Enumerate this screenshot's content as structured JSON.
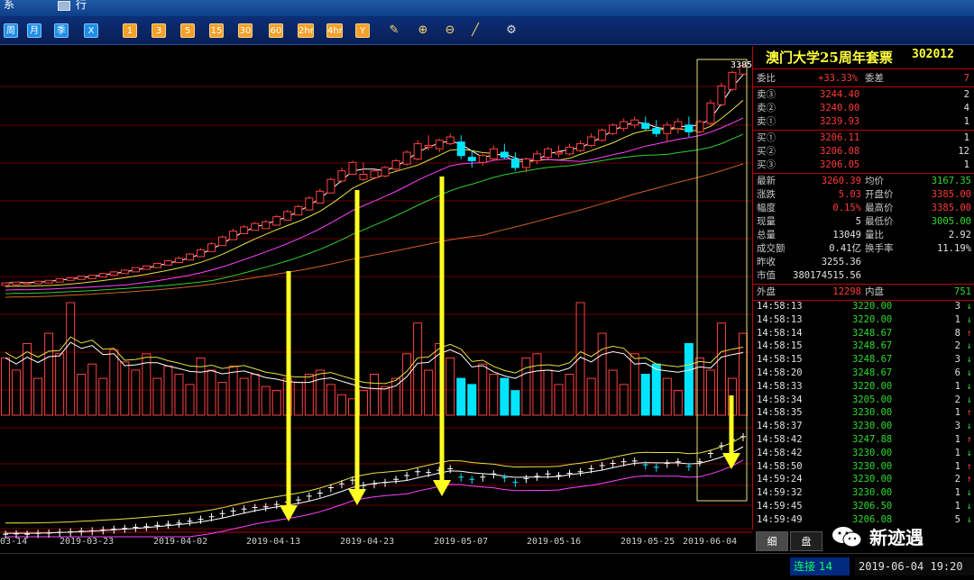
{
  "window": {
    "title_left": "系",
    "title_right": "行"
  },
  "toolbar": {
    "buttons": [
      {
        "label": "周",
        "style": "blue"
      },
      {
        "label": "月",
        "style": "blue"
      },
      {
        "label": "季",
        "style": "blue"
      },
      {
        "label": "X",
        "style": "blue"
      },
      {
        "label": "1",
        "style": "orange"
      },
      {
        "label": "3",
        "style": "orange"
      },
      {
        "label": "5",
        "style": "orange"
      },
      {
        "label": "15",
        "style": "orange"
      },
      {
        "label": "30",
        "style": "orange"
      },
      {
        "label": "60",
        "style": "orange"
      },
      {
        "label": "2hr",
        "style": "orange"
      },
      {
        "label": "4hr",
        "style": "orange"
      },
      {
        "label": "Y",
        "style": "orange"
      }
    ],
    "icons": [
      "notepad-icon",
      "zoom-in-icon",
      "zoom-out-icon",
      "draw-line-icon",
      "settings-gear-icon"
    ]
  },
  "chart_data": {
    "type": "candlestick",
    "xlabels": [
      "03-14",
      "2019-03-23",
      "2019-04-02",
      "2019-04-13",
      "2019-04-23",
      "2019-05-07",
      "2019-05-16",
      "2019-05-25",
      "2019-06-04"
    ],
    "last_price_label": "3385",
    "price_series": [
      [
        1,
        3,
        2,
        4
      ],
      [
        2,
        4,
        3,
        5
      ],
      [
        3,
        5,
        2,
        4
      ],
      [
        3,
        6,
        4,
        6
      ],
      [
        4,
        7,
        5,
        7
      ],
      [
        5,
        9,
        6,
        9
      ],
      [
        7,
        10,
        8,
        10
      ],
      [
        8,
        12,
        9,
        12
      ],
      [
        9,
        13,
        11,
        13
      ],
      [
        11,
        16,
        12,
        15
      ],
      [
        13,
        18,
        14,
        17
      ],
      [
        15,
        20,
        16,
        19
      ],
      [
        17,
        22,
        19,
        22
      ],
      [
        20,
        25,
        21,
        24
      ],
      [
        22,
        28,
        24,
        27
      ],
      [
        25,
        31,
        26,
        30
      ],
      [
        28,
        35,
        29,
        33
      ],
      [
        31,
        39,
        33,
        38
      ],
      [
        35,
        45,
        37,
        43
      ],
      [
        41,
        52,
        43,
        50
      ],
      [
        48,
        60,
        50,
        58
      ],
      [
        55,
        68,
        57,
        65
      ],
      [
        62,
        72,
        63,
        70
      ],
      [
        66,
        76,
        68,
        74
      ],
      [
        68,
        78,
        70,
        76
      ],
      [
        72,
        84,
        74,
        82
      ],
      [
        78,
        90,
        80,
        88
      ],
      [
        84,
        96,
        86,
        94
      ],
      [
        90,
        106,
        92,
        104
      ],
      [
        98,
        115,
        100,
        112
      ],
      [
        110,
        128,
        112,
        126
      ],
      [
        124,
        140,
        122,
        136
      ],
      [
        132,
        148,
        134,
        146
      ],
      [
        126,
        146,
        124,
        132
      ],
      [
        128,
        138,
        126,
        136
      ],
      [
        130,
        142,
        128,
        140
      ],
      [
        138,
        150,
        136,
        148
      ],
      [
        144,
        160,
        142,
        158
      ],
      [
        150,
        172,
        148,
        168
      ],
      [
        164,
        178,
        160,
        166
      ],
      [
        162,
        174,
        158,
        172
      ],
      [
        168,
        180,
        166,
        176
      ],
      [
        170,
        178,
        150,
        154
      ],
      [
        152,
        160,
        140,
        148
      ],
      [
        146,
        156,
        142,
        154
      ],
      [
        150,
        166,
        148,
        162
      ],
      [
        158,
        168,
        150,
        152
      ],
      [
        150,
        158,
        136,
        140
      ],
      [
        140,
        152,
        134,
        150
      ],
      [
        148,
        160,
        144,
        156
      ],
      [
        152,
        164,
        150,
        162
      ],
      [
        156,
        166,
        152,
        158
      ],
      [
        156,
        168,
        154,
        164
      ],
      [
        160,
        172,
        158,
        168
      ],
      [
        166,
        180,
        164,
        176
      ],
      [
        172,
        186,
        170,
        184
      ],
      [
        180,
        192,
        178,
        190
      ],
      [
        186,
        198,
        182,
        194
      ],
      [
        190,
        200,
        186,
        196
      ],
      [
        192,
        200,
        184,
        186
      ],
      [
        186,
        196,
        176,
        180
      ],
      [
        180,
        194,
        170,
        190
      ],
      [
        186,
        198,
        180,
        194
      ],
      [
        190,
        200,
        176,
        182
      ],
      [
        182,
        196,
        180,
        194
      ],
      [
        192,
        220,
        190,
        216
      ],
      [
        214,
        240,
        212,
        236
      ],
      [
        232,
        254,
        230,
        252
      ],
      [
        250,
        262,
        248,
        260
      ]
    ],
    "volume_series": [
      28,
      22,
      35,
      18,
      40,
      30,
      55,
      20,
      25,
      18,
      32,
      26,
      22,
      30,
      18,
      24,
      20,
      15,
      28,
      22,
      16,
      24,
      18,
      20,
      14,
      12,
      18,
      16,
      20,
      22,
      15,
      10,
      8,
      12,
      20,
      14,
      18,
      30,
      45,
      22,
      35,
      28,
      18,
      15,
      25,
      20,
      18,
      12,
      28,
      30,
      22,
      15,
      20,
      55,
      18,
      40,
      22,
      15,
      30,
      20,
      25,
      18,
      12,
      35,
      28,
      22,
      45,
      18,
      40
    ],
    "annotations": [
      "down-arrow",
      "down-arrow",
      "down-arrow",
      "down-arrow"
    ]
  },
  "quote": {
    "name": "澳门大学25周年套票",
    "code": "302012",
    "weibi_label": "委比",
    "weibi_value": "+33.33%",
    "weicha_label": "委差",
    "weicha_value": "7",
    "asks": [
      {
        "label": "卖③",
        "price": "3244.40",
        "qty": "2"
      },
      {
        "label": "卖②",
        "price": "3240.00",
        "qty": "4"
      },
      {
        "label": "卖①",
        "price": "3239.93",
        "qty": "1"
      }
    ],
    "bids": [
      {
        "label": "买①",
        "price": "3206.11",
        "qty": "1"
      },
      {
        "label": "买②",
        "price": "3206.08",
        "qty": "12"
      },
      {
        "label": "买③",
        "price": "3206.05",
        "qty": "1"
      }
    ],
    "stats": [
      {
        "l1": "最新",
        "v1": "3260.39",
        "c1": "red",
        "l2": "均价",
        "v2": "3167.35",
        "c2": "green"
      },
      {
        "l1": "涨跌",
        "v1": "5.03",
        "c1": "red",
        "l2": "开盘价",
        "v2": "3385.00",
        "c2": "red"
      },
      {
        "l1": "幅度",
        "v1": "0.15%",
        "c1": "red",
        "l2": "最高价",
        "v2": "3385.00",
        "c2": "red"
      },
      {
        "l1": "现量",
        "v1": "5",
        "c1": "white",
        "l2": "最低价",
        "v2": "3005.00",
        "c2": "green"
      },
      {
        "l1": "总量",
        "v1": "13049",
        "c1": "white",
        "l2": "量比",
        "v2": "2.92",
        "c2": "white"
      },
      {
        "l1": "成交额",
        "v1": "0.41亿",
        "c1": "white",
        "l2": "换手率",
        "v2": "11.19%",
        "c2": "white"
      }
    ],
    "prev_close_label": "昨收",
    "prev_close": "3255.36",
    "market_value_label": "市值",
    "market_value": "380174515.56",
    "outer_label": "外盘",
    "outer_value": "12298",
    "inner_label": "内盘",
    "inner_value": "751"
  },
  "ticks": [
    {
      "time": "14:58:13",
      "price": "3220.00",
      "qty": "3",
      "dir": "down"
    },
    {
      "time": "14:58:13",
      "price": "3220.00",
      "qty": "1",
      "dir": "down"
    },
    {
      "time": "14:58:14",
      "price": "3248.67",
      "qty": "8",
      "dir": "up"
    },
    {
      "time": "14:58:15",
      "price": "3248.67",
      "qty": "2",
      "dir": "down"
    },
    {
      "time": "14:58:15",
      "price": "3248.67",
      "qty": "3",
      "dir": "down"
    },
    {
      "time": "14:58:20",
      "price": "3248.67",
      "qty": "6",
      "dir": "down"
    },
    {
      "time": "14:58:33",
      "price": "3220.00",
      "qty": "1",
      "dir": "down"
    },
    {
      "time": "14:58:34",
      "price": "3205.00",
      "qty": "2",
      "dir": "down"
    },
    {
      "time": "14:58:35",
      "price": "3230.00",
      "qty": "1",
      "dir": "up"
    },
    {
      "time": "14:58:37",
      "price": "3230.00",
      "qty": "3",
      "dir": "down"
    },
    {
      "time": "14:58:42",
      "price": "3247.88",
      "qty": "1",
      "dir": "up"
    },
    {
      "time": "14:58:42",
      "price": "3230.00",
      "qty": "1",
      "dir": "down"
    },
    {
      "time": "14:58:50",
      "price": "3230.00",
      "qty": "1",
      "dir": "up"
    },
    {
      "time": "14:59:24",
      "price": "3230.00",
      "qty": "2",
      "dir": "up"
    },
    {
      "time": "14:59:32",
      "price": "3230.00",
      "qty": "1",
      "dir": "down"
    },
    {
      "time": "14:59:45",
      "price": "3206.50",
      "qty": "1",
      "dir": "down"
    },
    {
      "time": "14:59:49",
      "price": "3206.08",
      "qty": "5",
      "dir": "down"
    }
  ],
  "tabs": [
    {
      "label": "细"
    },
    {
      "label": "盘"
    }
  ],
  "status": {
    "connection": "连接 14",
    "datetime": "2019-06-04 19:20"
  },
  "watermark": {
    "text": "新迹遇"
  }
}
